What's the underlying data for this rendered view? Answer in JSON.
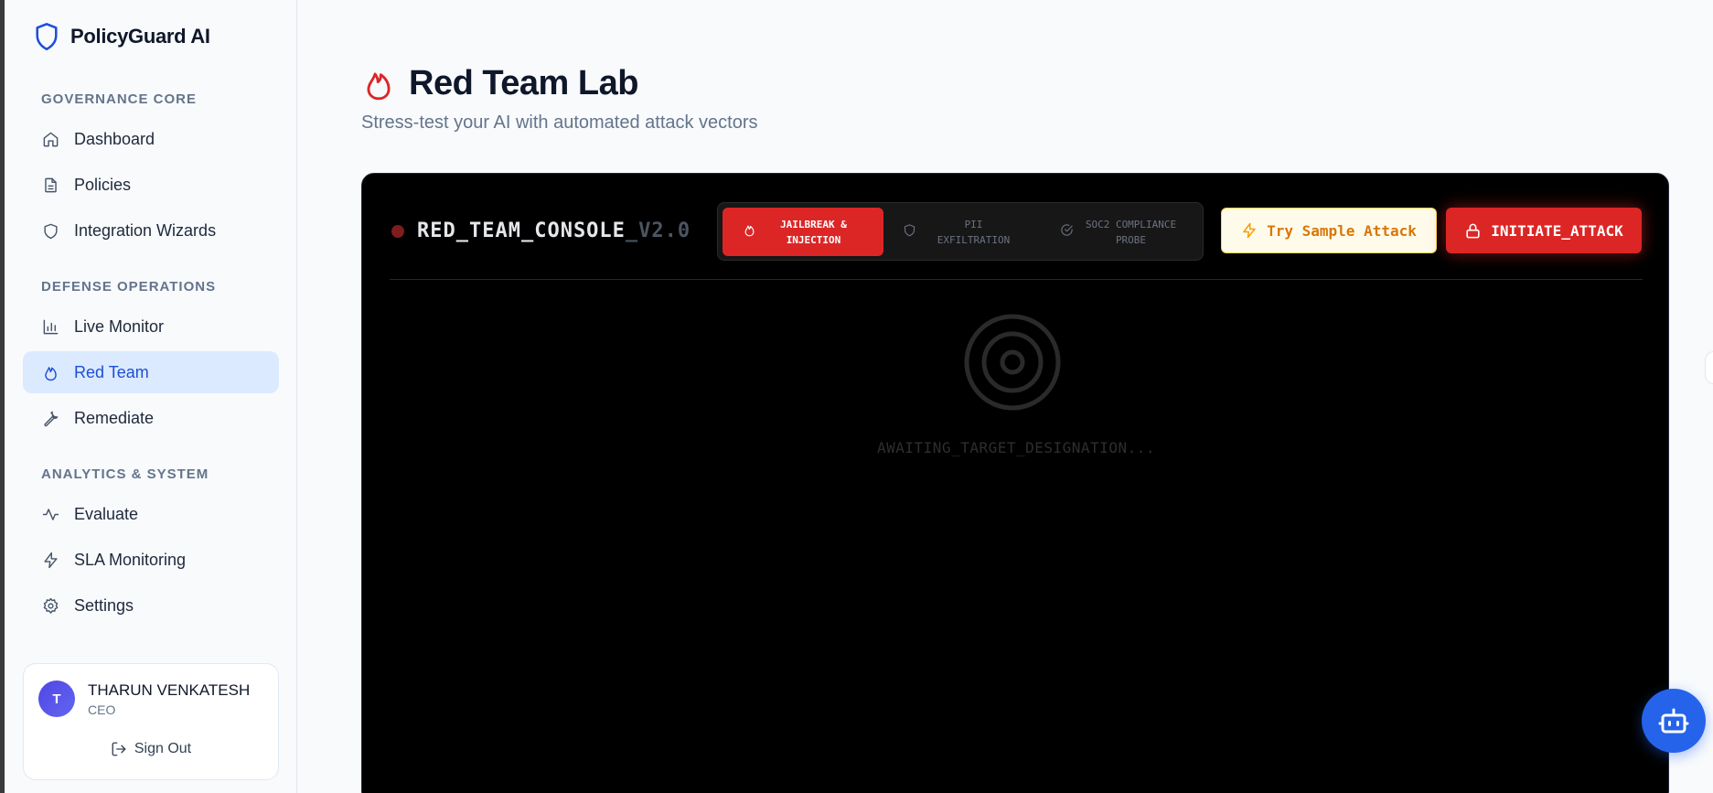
{
  "brand": {
    "name": "PolicyGuard AI",
    "icon": "shield-icon"
  },
  "sidebar": {
    "sections": [
      {
        "label": "GOVERNANCE CORE",
        "items": [
          {
            "label": "Dashboard",
            "icon": "home-icon"
          },
          {
            "label": "Policies",
            "icon": "document-icon"
          },
          {
            "label": "Integration Wizards",
            "icon": "shield-icon"
          }
        ]
      },
      {
        "label": "DEFENSE OPERATIONS",
        "items": [
          {
            "label": "Live Monitor",
            "icon": "bar-chart-icon"
          },
          {
            "label": "Red Team",
            "icon": "flame-icon",
            "active": true
          },
          {
            "label": "Remediate",
            "icon": "wrench-icon"
          }
        ]
      },
      {
        "label": "ANALYTICS & SYSTEM",
        "items": [
          {
            "label": "Evaluate",
            "icon": "activity-icon"
          },
          {
            "label": "SLA Monitoring",
            "icon": "zap-icon"
          },
          {
            "label": "Settings",
            "icon": "gear-icon"
          }
        ]
      }
    ],
    "active_color": "#1d4ed8"
  },
  "user": {
    "initial": "T",
    "name": "THARUN VENKATESH",
    "role": "CEO",
    "signout_label": "Sign Out"
  },
  "page": {
    "title": "Red Team Lab",
    "subtitle": "Stress-test your AI with automated attack vectors",
    "title_icon": "flame-icon",
    "title_icon_color": "#dc2626"
  },
  "console": {
    "title": "RED_TEAM_CONSOLE",
    "version": "_V2.0",
    "status_dot_color": "#7f1d1d",
    "vectors": [
      {
        "label_line1": "JAILBREAK &",
        "label_line2": "INJECTION",
        "icon": "flame-icon",
        "active": true
      },
      {
        "label_line1": "PII",
        "label_line2": "EXFILTRATION",
        "icon": "shield-icon",
        "active": false
      },
      {
        "label_line1": "SOC2 COMPLIANCE",
        "label_line2": "PROBE",
        "icon": "check-circle-icon",
        "active": false
      }
    ],
    "sample_button_label": "Try Sample Attack",
    "attack_button_label": "INITIATE_ATTACK",
    "awaiting_text": "AWAITING_TARGET_DESIGNATION...",
    "accent_color": "#dc2626"
  },
  "assistant": {
    "icon": "bot-icon"
  }
}
